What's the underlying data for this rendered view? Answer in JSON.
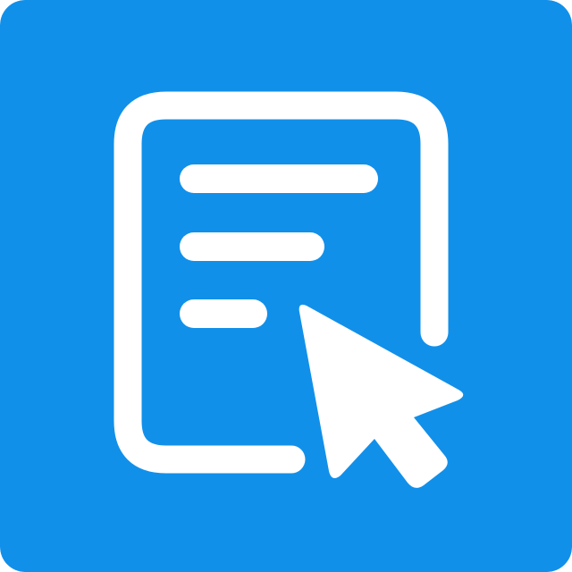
{
  "icon": {
    "name": "document-cursor-icon",
    "background_color": "#1190EA",
    "foreground_color": "#FFFFFF",
    "parts": [
      "document-outline",
      "text-line",
      "text-line",
      "text-line",
      "mouse-pointer"
    ]
  }
}
